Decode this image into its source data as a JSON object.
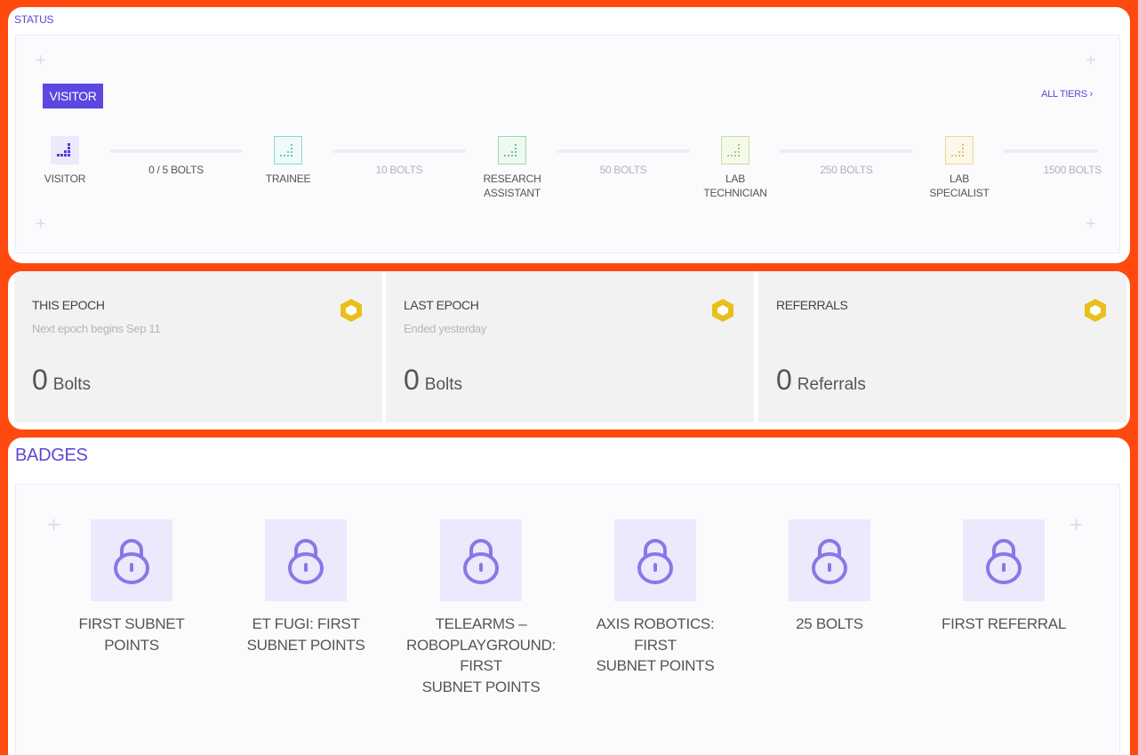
{
  "status": {
    "title": "STATUS",
    "current_tier": "VISITOR",
    "all_tiers_label": "ALL TIERS ›",
    "tiers": [
      {
        "label": "VISITOR",
        "color": "#4b3fd8"
      },
      {
        "label": "TRAINEE",
        "color": "#6cc8c0"
      },
      {
        "label": "RESEARCH\nASSISTANT",
        "color": "#72c98c"
      },
      {
        "label": "LAB\nTECHNICIAN",
        "color": "#a6cf7a"
      },
      {
        "label": "LAB\nSPECIALIST",
        "color": "#e3c462"
      }
    ],
    "thresholds": [
      "0 / 5 BOLTS",
      "10 BOLTS",
      "50 BOLTS",
      "250 BOLTS",
      "1500 BOLTS"
    ]
  },
  "epochs": [
    {
      "title": "THIS EPOCH",
      "subtitle": "Next epoch begins Sep 11",
      "value": "0",
      "unit": "Bolts"
    },
    {
      "title": "LAST EPOCH",
      "subtitle": "Ended yesterday",
      "value": "0",
      "unit": "Bolts"
    },
    {
      "title": "REFERRALS",
      "subtitle": "",
      "value": "0",
      "unit": "Referrals"
    }
  ],
  "badges": {
    "title": "BADGES",
    "items": [
      {
        "label": "FIRST SUBNET\nPOINTS",
        "icon": "lock-icon"
      },
      {
        "label": "ET FUGI: FIRST\nSUBNET POINTS",
        "icon": "lock-icon"
      },
      {
        "label": "TELEARMS –\nROBOPLAYGROUND:\nFIRST\nSUBNET POINTS",
        "icon": "lock-icon"
      },
      {
        "label": "AXIS ROBOTICS:\nFIRST\nSUBNET POINTS",
        "icon": "lock-icon"
      },
      {
        "label": "25 BOLTS",
        "icon": "lock-icon"
      },
      {
        "label": "FIRST REFERRAL",
        "icon": "lock-icon"
      }
    ]
  },
  "colors": {
    "accent": "#5b48d6",
    "frame": "#ff4a0f",
    "hex_icon": "#e9bf1a",
    "lock": "#8a77e6"
  }
}
